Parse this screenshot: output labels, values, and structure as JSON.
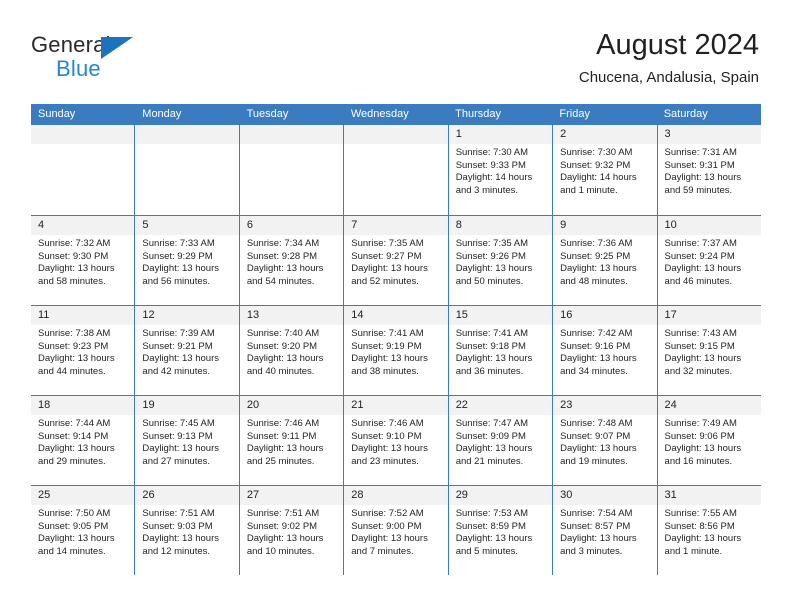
{
  "brand": {
    "name_top": "General",
    "name_bottom": "Blue",
    "accent_color": "#1c72bd",
    "blue_text_color": "#2288d6"
  },
  "header": {
    "title": "August 2024",
    "subtitle": "Chucena, Andalusia, Spain"
  },
  "theme": {
    "header_blue": "#3b7cc0",
    "day_band_gray": "#f2f2f2",
    "text_color": "#231f20"
  },
  "calendar": {
    "weekday_headers": [
      "Sunday",
      "Monday",
      "Tuesday",
      "Wednesday",
      "Thursday",
      "Friday",
      "Saturday"
    ],
    "weeks": [
      [
        {
          "day": "",
          "empty": true,
          "sunrise": "",
          "sunset": "",
          "daylight_line1": "",
          "daylight_line2": ""
        },
        {
          "day": "",
          "empty": true,
          "sunrise": "",
          "sunset": "",
          "daylight_line1": "",
          "daylight_line2": ""
        },
        {
          "day": "",
          "empty": true,
          "sunrise": "",
          "sunset": "",
          "daylight_line1": "",
          "daylight_line2": ""
        },
        {
          "day": "",
          "empty": true,
          "sunrise": "",
          "sunset": "",
          "daylight_line1": "",
          "daylight_line2": ""
        },
        {
          "day": "1",
          "empty": false,
          "sunrise": "Sunrise: 7:30 AM",
          "sunset": "Sunset: 9:33 PM",
          "daylight_line1": "Daylight: 14 hours",
          "daylight_line2": "and 3 minutes."
        },
        {
          "day": "2",
          "empty": false,
          "sunrise": "Sunrise: 7:30 AM",
          "sunset": "Sunset: 9:32 PM",
          "daylight_line1": "Daylight: 14 hours",
          "daylight_line2": "and 1 minute."
        },
        {
          "day": "3",
          "empty": false,
          "sunrise": "Sunrise: 7:31 AM",
          "sunset": "Sunset: 9:31 PM",
          "daylight_line1": "Daylight: 13 hours",
          "daylight_line2": "and 59 minutes."
        }
      ],
      [
        {
          "day": "4",
          "empty": false,
          "sunrise": "Sunrise: 7:32 AM",
          "sunset": "Sunset: 9:30 PM",
          "daylight_line1": "Daylight: 13 hours",
          "daylight_line2": "and 58 minutes."
        },
        {
          "day": "5",
          "empty": false,
          "sunrise": "Sunrise: 7:33 AM",
          "sunset": "Sunset: 9:29 PM",
          "daylight_line1": "Daylight: 13 hours",
          "daylight_line2": "and 56 minutes."
        },
        {
          "day": "6",
          "empty": false,
          "sunrise": "Sunrise: 7:34 AM",
          "sunset": "Sunset: 9:28 PM",
          "daylight_line1": "Daylight: 13 hours",
          "daylight_line2": "and 54 minutes."
        },
        {
          "day": "7",
          "empty": false,
          "sunrise": "Sunrise: 7:35 AM",
          "sunset": "Sunset: 9:27 PM",
          "daylight_line1": "Daylight: 13 hours",
          "daylight_line2": "and 52 minutes."
        },
        {
          "day": "8",
          "empty": false,
          "sunrise": "Sunrise: 7:35 AM",
          "sunset": "Sunset: 9:26 PM",
          "daylight_line1": "Daylight: 13 hours",
          "daylight_line2": "and 50 minutes."
        },
        {
          "day": "9",
          "empty": false,
          "sunrise": "Sunrise: 7:36 AM",
          "sunset": "Sunset: 9:25 PM",
          "daylight_line1": "Daylight: 13 hours",
          "daylight_line2": "and 48 minutes."
        },
        {
          "day": "10",
          "empty": false,
          "sunrise": "Sunrise: 7:37 AM",
          "sunset": "Sunset: 9:24 PM",
          "daylight_line1": "Daylight: 13 hours",
          "daylight_line2": "and 46 minutes."
        }
      ],
      [
        {
          "day": "11",
          "empty": false,
          "sunrise": "Sunrise: 7:38 AM",
          "sunset": "Sunset: 9:23 PM",
          "daylight_line1": "Daylight: 13 hours",
          "daylight_line2": "and 44 minutes."
        },
        {
          "day": "12",
          "empty": false,
          "sunrise": "Sunrise: 7:39 AM",
          "sunset": "Sunset: 9:21 PM",
          "daylight_line1": "Daylight: 13 hours",
          "daylight_line2": "and 42 minutes."
        },
        {
          "day": "13",
          "empty": false,
          "sunrise": "Sunrise: 7:40 AM",
          "sunset": "Sunset: 9:20 PM",
          "daylight_line1": "Daylight: 13 hours",
          "daylight_line2": "and 40 minutes."
        },
        {
          "day": "14",
          "empty": false,
          "sunrise": "Sunrise: 7:41 AM",
          "sunset": "Sunset: 9:19 PM",
          "daylight_line1": "Daylight: 13 hours",
          "daylight_line2": "and 38 minutes."
        },
        {
          "day": "15",
          "empty": false,
          "sunrise": "Sunrise: 7:41 AM",
          "sunset": "Sunset: 9:18 PM",
          "daylight_line1": "Daylight: 13 hours",
          "daylight_line2": "and 36 minutes."
        },
        {
          "day": "16",
          "empty": false,
          "sunrise": "Sunrise: 7:42 AM",
          "sunset": "Sunset: 9:16 PM",
          "daylight_line1": "Daylight: 13 hours",
          "daylight_line2": "and 34 minutes."
        },
        {
          "day": "17",
          "empty": false,
          "sunrise": "Sunrise: 7:43 AM",
          "sunset": "Sunset: 9:15 PM",
          "daylight_line1": "Daylight: 13 hours",
          "daylight_line2": "and 32 minutes."
        }
      ],
      [
        {
          "day": "18",
          "empty": false,
          "sunrise": "Sunrise: 7:44 AM",
          "sunset": "Sunset: 9:14 PM",
          "daylight_line1": "Daylight: 13 hours",
          "daylight_line2": "and 29 minutes."
        },
        {
          "day": "19",
          "empty": false,
          "sunrise": "Sunrise: 7:45 AM",
          "sunset": "Sunset: 9:13 PM",
          "daylight_line1": "Daylight: 13 hours",
          "daylight_line2": "and 27 minutes."
        },
        {
          "day": "20",
          "empty": false,
          "sunrise": "Sunrise: 7:46 AM",
          "sunset": "Sunset: 9:11 PM",
          "daylight_line1": "Daylight: 13 hours",
          "daylight_line2": "and 25 minutes."
        },
        {
          "day": "21",
          "empty": false,
          "sunrise": "Sunrise: 7:46 AM",
          "sunset": "Sunset: 9:10 PM",
          "daylight_line1": "Daylight: 13 hours",
          "daylight_line2": "and 23 minutes."
        },
        {
          "day": "22",
          "empty": false,
          "sunrise": "Sunrise: 7:47 AM",
          "sunset": "Sunset: 9:09 PM",
          "daylight_line1": "Daylight: 13 hours",
          "daylight_line2": "and 21 minutes."
        },
        {
          "day": "23",
          "empty": false,
          "sunrise": "Sunrise: 7:48 AM",
          "sunset": "Sunset: 9:07 PM",
          "daylight_line1": "Daylight: 13 hours",
          "daylight_line2": "and 19 minutes."
        },
        {
          "day": "24",
          "empty": false,
          "sunrise": "Sunrise: 7:49 AM",
          "sunset": "Sunset: 9:06 PM",
          "daylight_line1": "Daylight: 13 hours",
          "daylight_line2": "and 16 minutes."
        }
      ],
      [
        {
          "day": "25",
          "empty": false,
          "sunrise": "Sunrise: 7:50 AM",
          "sunset": "Sunset: 9:05 PM",
          "daylight_line1": "Daylight: 13 hours",
          "daylight_line2": "and 14 minutes."
        },
        {
          "day": "26",
          "empty": false,
          "sunrise": "Sunrise: 7:51 AM",
          "sunset": "Sunset: 9:03 PM",
          "daylight_line1": "Daylight: 13 hours",
          "daylight_line2": "and 12 minutes."
        },
        {
          "day": "27",
          "empty": false,
          "sunrise": "Sunrise: 7:51 AM",
          "sunset": "Sunset: 9:02 PM",
          "daylight_line1": "Daylight: 13 hours",
          "daylight_line2": "and 10 minutes."
        },
        {
          "day": "28",
          "empty": false,
          "sunrise": "Sunrise: 7:52 AM",
          "sunset": "Sunset: 9:00 PM",
          "daylight_line1": "Daylight: 13 hours",
          "daylight_line2": "and 7 minutes."
        },
        {
          "day": "29",
          "empty": false,
          "sunrise": "Sunrise: 7:53 AM",
          "sunset": "Sunset: 8:59 PM",
          "daylight_line1": "Daylight: 13 hours",
          "daylight_line2": "and 5 minutes."
        },
        {
          "day": "30",
          "empty": false,
          "sunrise": "Sunrise: 7:54 AM",
          "sunset": "Sunset: 8:57 PM",
          "daylight_line1": "Daylight: 13 hours",
          "daylight_line2": "and 3 minutes."
        },
        {
          "day": "31",
          "empty": false,
          "sunrise": "Sunrise: 7:55 AM",
          "sunset": "Sunset: 8:56 PM",
          "daylight_line1": "Daylight: 13 hours",
          "daylight_line2": "and 1 minute."
        }
      ]
    ]
  }
}
